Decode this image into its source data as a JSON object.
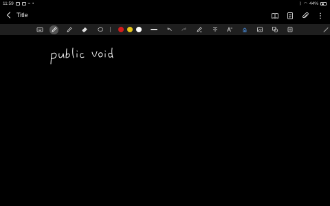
{
  "status_bar": {
    "time": "11:59",
    "battery": "44%"
  },
  "header": {
    "title": "Title"
  },
  "toolbar": {
    "tools": [
      "keyboard-icon",
      "pen-icon",
      "highlighter-icon",
      "eraser-icon",
      "lasso-icon"
    ],
    "selected_tool": "pen-icon",
    "colors": [
      "#d21b1b",
      "#e6c619",
      "#ffffff"
    ],
    "actions": [
      "undo-icon",
      "redo-icon",
      "shape-pen-icon",
      "text-icon",
      "text-style-icon",
      "favorite-pen-icon",
      "image-icon",
      "shapes-icon",
      "sticker-icon"
    ]
  },
  "canvas": {
    "handwriting": "public void"
  },
  "colors": {
    "background": "#000000",
    "toolbar_bg": "#1f1f1f",
    "ink": "#ffffff"
  }
}
